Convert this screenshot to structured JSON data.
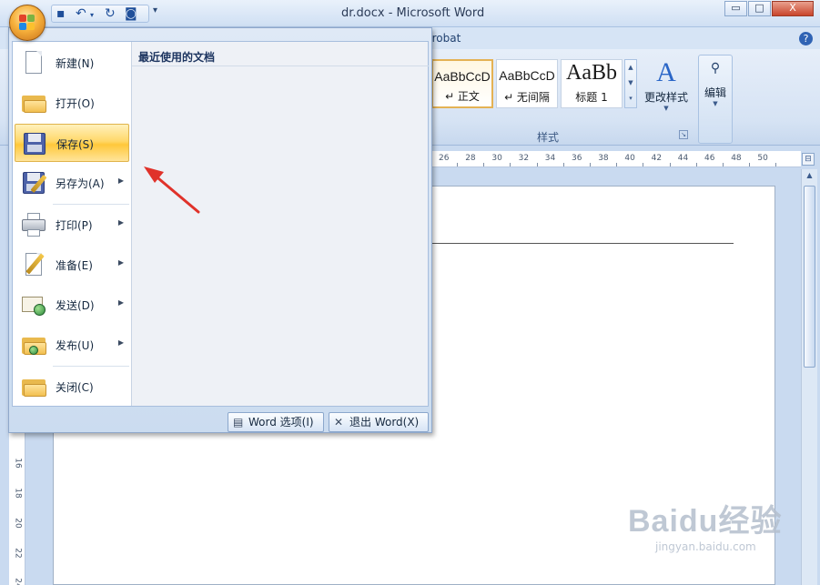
{
  "window": {
    "title": "dr.docx - Microsoft Word",
    "controls": {
      "minimize": "▭",
      "maximize": "□",
      "close": "X"
    }
  },
  "quick_access": {
    "save_icon": "save-icon",
    "undo_icon": "undo-icon",
    "redo_icon": "redo-icon",
    "preview_icon": "print-preview-icon",
    "customize": "▾"
  },
  "ribbon": {
    "partial_tab": "crobat",
    "help": "?",
    "styles": [
      {
        "sample": "AaBbCcD",
        "name": "↵ 正文",
        "active": true
      },
      {
        "sample": "AaBbCcD",
        "name": "↵ 无间隔",
        "active": false
      },
      {
        "sample": "AaBb",
        "name": "标题 1",
        "active": false
      }
    ],
    "change_styles_label": "更改样式",
    "styles_group_label": "样式",
    "edit_label": "编辑"
  },
  "ruler": {
    "numbers": [
      "26",
      "28",
      "30",
      "32",
      "34",
      "36",
      "38",
      "40",
      "42",
      "44",
      "46",
      "48",
      "50"
    ]
  },
  "vruler": {
    "numbers": [
      "16",
      "18",
      "20",
      "22",
      "24"
    ]
  },
  "office_menu": {
    "items": [
      {
        "label": "新建(N)",
        "icon": "new-document-icon",
        "submenu": false,
        "active": false
      },
      {
        "label": "打开(O)",
        "icon": "open-folder-icon",
        "submenu": false,
        "active": false
      },
      {
        "label": "保存(S)",
        "icon": "save-icon",
        "submenu": false,
        "active": true
      },
      {
        "label": "另存为(A)",
        "icon": "save-as-icon",
        "submenu": true,
        "active": false
      },
      {
        "label": "打印(P)",
        "icon": "printer-icon",
        "submenu": true,
        "active": false
      },
      {
        "label": "准备(E)",
        "icon": "prepare-icon",
        "submenu": true,
        "active": false
      },
      {
        "label": "发送(D)",
        "icon": "send-icon",
        "submenu": true,
        "active": false
      },
      {
        "label": "发布(U)",
        "icon": "publish-icon",
        "submenu": true,
        "active": false
      },
      {
        "label": "关闭(C)",
        "icon": "close-folder-icon",
        "submenu": false,
        "active": false
      }
    ],
    "recent_title": "最近使用的文档",
    "word_options_label": "Word 选项(I)",
    "exit_label": "退出 Word(X)"
  },
  "watermark": {
    "text": "Baidu经验",
    "url_text": "jingyan.baidu.com"
  },
  "colors": {
    "accent_highlight": "#ffc83a",
    "ribbon_bg": "#d6e3f4",
    "annotation_arrow": "#e0322a"
  }
}
